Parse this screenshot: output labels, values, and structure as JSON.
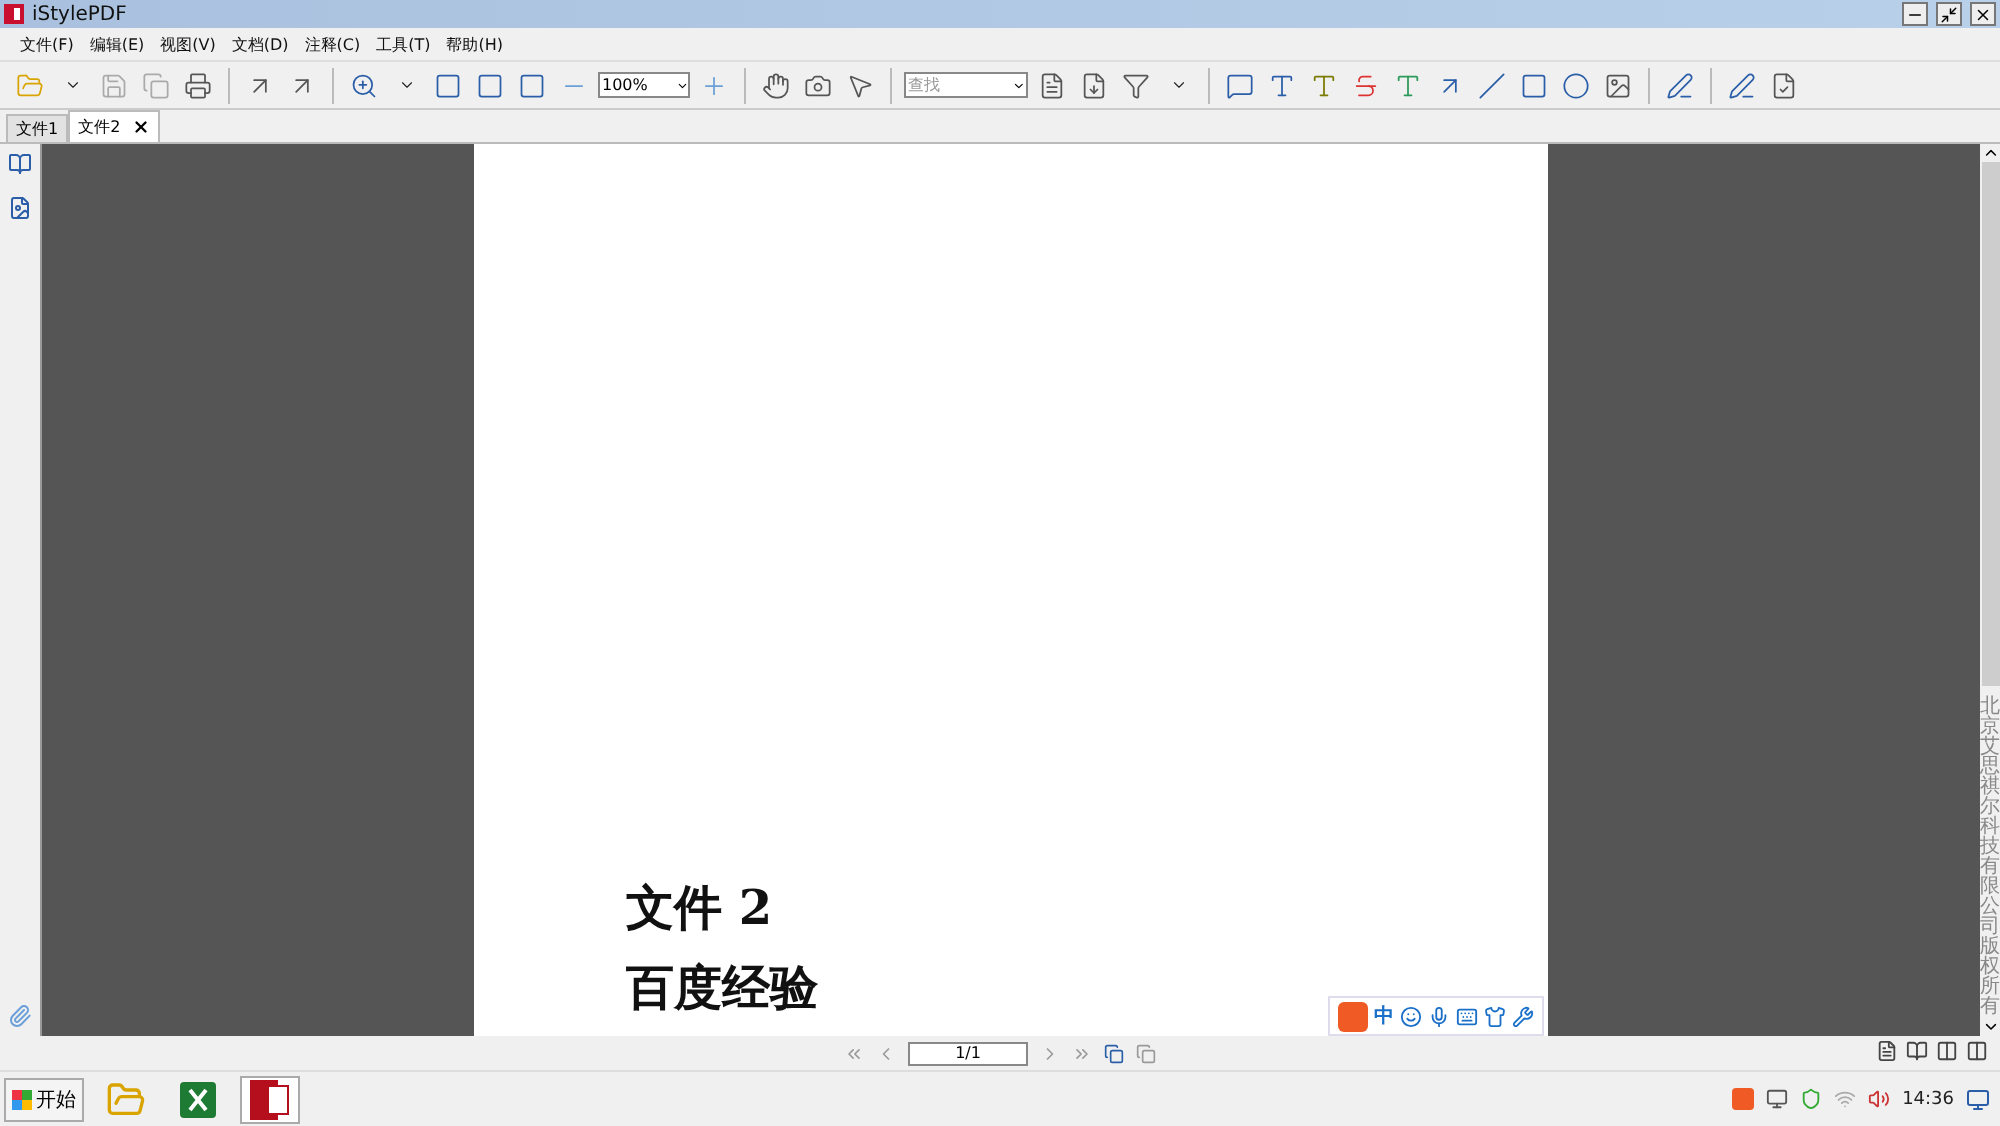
{
  "window": {
    "title": "iStylePDF"
  },
  "menu": [
    {
      "label": "文件(F)"
    },
    {
      "label": "编辑(E)"
    },
    {
      "label": "视图(V)"
    },
    {
      "label": "文档(D)"
    },
    {
      "label": "注释(C)"
    },
    {
      "label": "工具(T)"
    },
    {
      "label": "帮助(H)"
    }
  ],
  "toolbar": {
    "zoom": {
      "value": "100%"
    },
    "find": {
      "placeholder": "查找"
    }
  },
  "tabs": [
    {
      "label": "文件1",
      "selected": false
    },
    {
      "label": "文件2",
      "selected": true
    }
  ],
  "document": {
    "lines": [
      "文件 2",
      "百度经验"
    ]
  },
  "ime_bar": {
    "mode": "中"
  },
  "scrollbar_text": "北京艾思祺尔科技有限公司版权所有",
  "page_nav": {
    "value": "1/1"
  },
  "taskbar": {
    "start": "开始",
    "clock": "14:36"
  }
}
